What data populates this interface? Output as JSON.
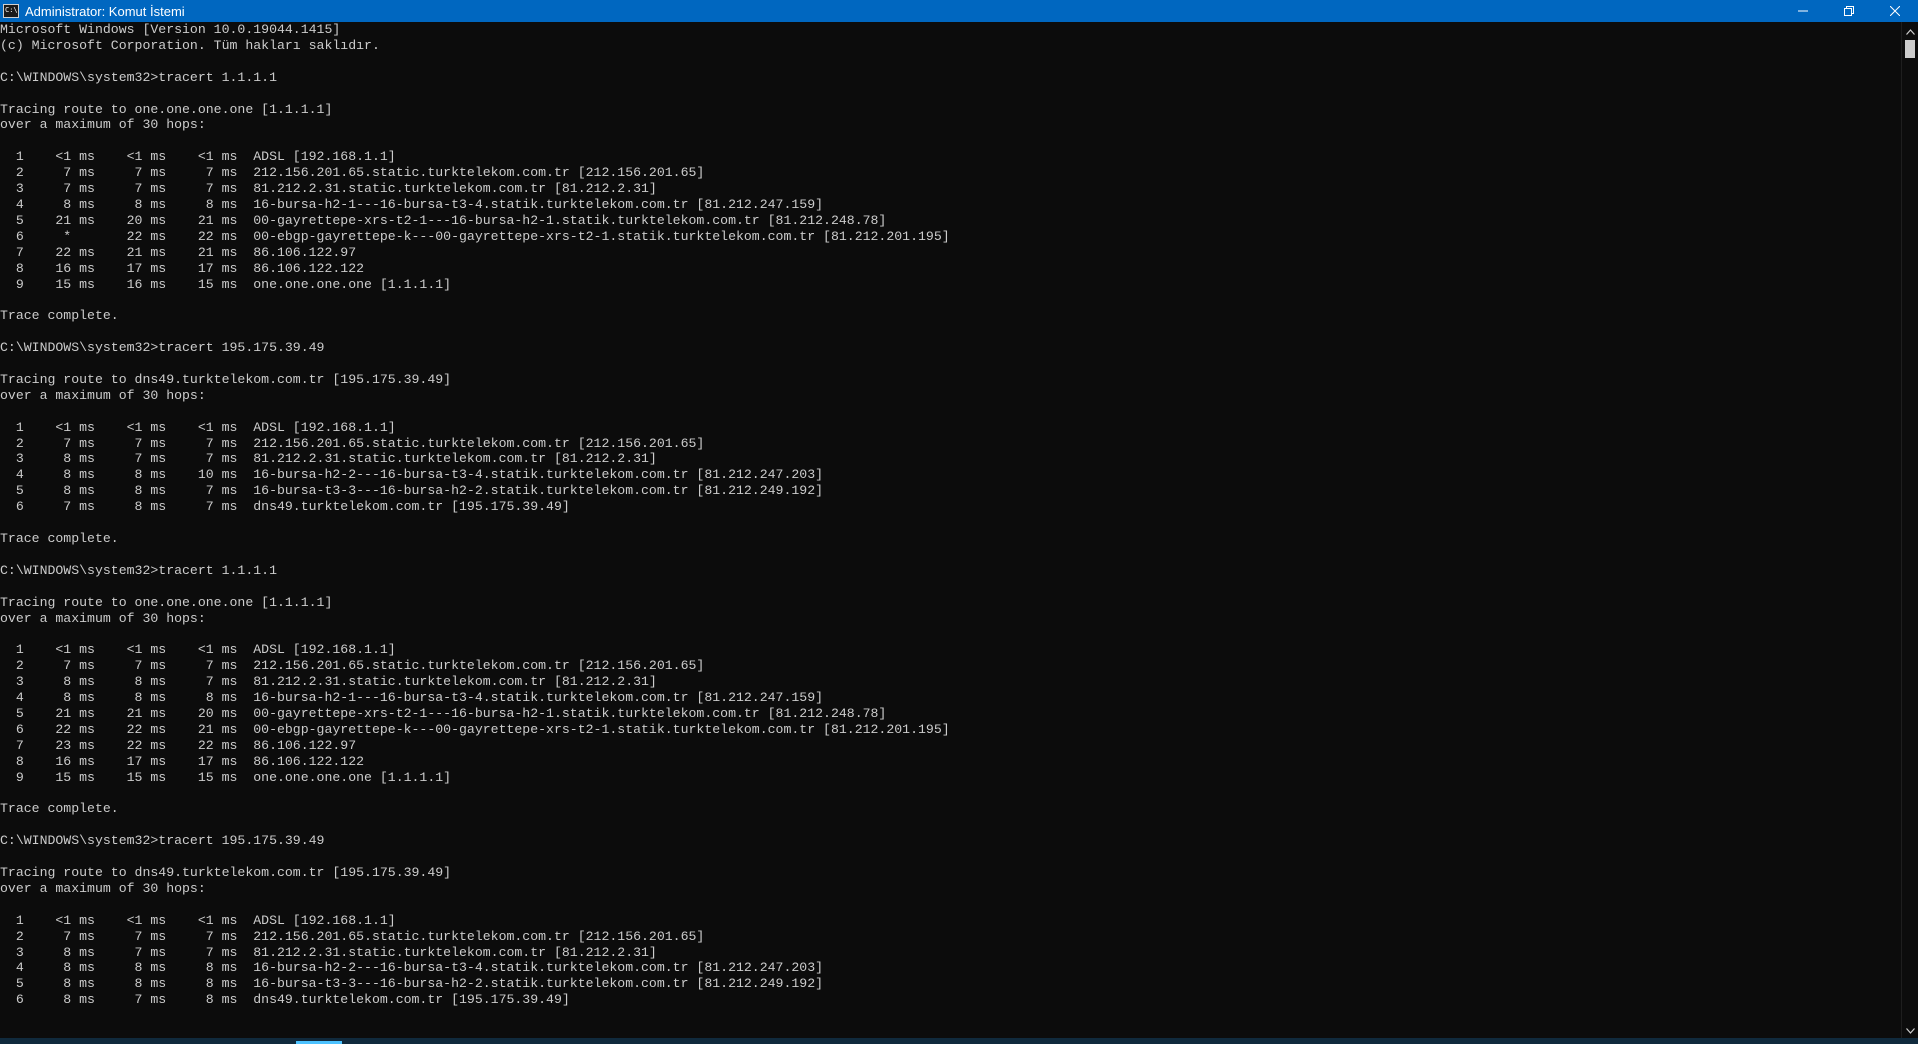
{
  "window": {
    "title": "Administrator: Komut İstemi",
    "icon_text": "C:\\",
    "controls": {
      "minimize": "minimize-icon",
      "restore": "restore-icon",
      "close": "close-icon"
    }
  },
  "console": {
    "lines": [
      "Microsoft Windows [Version 10.0.19044.1415]",
      "(c) Microsoft Corporation. Tüm hakları saklıdır.",
      "",
      "C:\\WINDOWS\\system32>tracert 1.1.1.1",
      "",
      "Tracing route to one.one.one.one [1.1.1.1]",
      "over a maximum of 30 hops:",
      "",
      "  1    <1 ms    <1 ms    <1 ms  ADSL [192.168.1.1]",
      "  2     7 ms     7 ms     7 ms  212.156.201.65.static.turktelekom.com.tr [212.156.201.65]",
      "  3     7 ms     7 ms     7 ms  81.212.2.31.static.turktelekom.com.tr [81.212.2.31]",
      "  4     8 ms     8 ms     8 ms  16-bursa-h2-1---16-bursa-t3-4.statik.turktelekom.com.tr [81.212.247.159]",
      "  5    21 ms    20 ms    21 ms  00-gayrettepe-xrs-t2-1---16-bursa-h2-1.statik.turktelekom.com.tr [81.212.248.78]",
      "  6     *       22 ms    22 ms  00-ebgp-gayrettepe-k---00-gayrettepe-xrs-t2-1.statik.turktelekom.com.tr [81.212.201.195]",
      "  7    22 ms    21 ms    21 ms  86.106.122.97",
      "  8    16 ms    17 ms    17 ms  86.106.122.122",
      "  9    15 ms    16 ms    15 ms  one.one.one.one [1.1.1.1]",
      "",
      "Trace complete.",
      "",
      "C:\\WINDOWS\\system32>tracert 195.175.39.49",
      "",
      "Tracing route to dns49.turktelekom.com.tr [195.175.39.49]",
      "over a maximum of 30 hops:",
      "",
      "  1    <1 ms    <1 ms    <1 ms  ADSL [192.168.1.1]",
      "  2     7 ms     7 ms     7 ms  212.156.201.65.static.turktelekom.com.tr [212.156.201.65]",
      "  3     8 ms     7 ms     7 ms  81.212.2.31.static.turktelekom.com.tr [81.212.2.31]",
      "  4     8 ms     8 ms    10 ms  16-bursa-h2-2---16-bursa-t3-4.statik.turktelekom.com.tr [81.212.247.203]",
      "  5     8 ms     8 ms     7 ms  16-bursa-t3-3---16-bursa-h2-2.statik.turktelekom.com.tr [81.212.249.192]",
      "  6     7 ms     8 ms     7 ms  dns49.turktelekom.com.tr [195.175.39.49]",
      "",
      "Trace complete.",
      "",
      "C:\\WINDOWS\\system32>tracert 1.1.1.1",
      "",
      "Tracing route to one.one.one.one [1.1.1.1]",
      "over a maximum of 30 hops:",
      "",
      "  1    <1 ms    <1 ms    <1 ms  ADSL [192.168.1.1]",
      "  2     7 ms     7 ms     7 ms  212.156.201.65.static.turktelekom.com.tr [212.156.201.65]",
      "  3     8 ms     8 ms     7 ms  81.212.2.31.static.turktelekom.com.tr [81.212.2.31]",
      "  4     8 ms     8 ms     8 ms  16-bursa-h2-1---16-bursa-t3-4.statik.turktelekom.com.tr [81.212.247.159]",
      "  5    21 ms    21 ms    20 ms  00-gayrettepe-xrs-t2-1---16-bursa-h2-1.statik.turktelekom.com.tr [81.212.248.78]",
      "  6    22 ms    22 ms    21 ms  00-ebgp-gayrettepe-k---00-gayrettepe-xrs-t2-1.statik.turktelekom.com.tr [81.212.201.195]",
      "  7    23 ms    22 ms    22 ms  86.106.122.97",
      "  8    16 ms    17 ms    17 ms  86.106.122.122",
      "  9    15 ms    15 ms    15 ms  one.one.one.one [1.1.1.1]",
      "",
      "Trace complete.",
      "",
      "C:\\WINDOWS\\system32>tracert 195.175.39.49",
      "",
      "Tracing route to dns49.turktelekom.com.tr [195.175.39.49]",
      "over a maximum of 30 hops:",
      "",
      "  1    <1 ms    <1 ms    <1 ms  ADSL [192.168.1.1]",
      "  2     7 ms     7 ms     7 ms  212.156.201.65.static.turktelekom.com.tr [212.156.201.65]",
      "  3     8 ms     7 ms     7 ms  81.212.2.31.static.turktelekom.com.tr [81.212.2.31]",
      "  4     8 ms     8 ms     8 ms  16-bursa-h2-2---16-bursa-t3-4.statik.turktelekom.com.tr [81.212.247.203]",
      "  5     8 ms     8 ms     8 ms  16-bursa-t3-3---16-bursa-h2-2.statik.turktelekom.com.tr [81.212.249.192]",
      "  6     8 ms     7 ms     8 ms  dns49.turktelekom.com.tr [195.175.39.49]"
    ]
  },
  "scrollbar": {
    "up_icon": "scroll-up-arrow-icon",
    "down_icon": "scroll-down-arrow-icon"
  },
  "colors": {
    "titlebar": "#0067c0",
    "console_bg": "#0c0c0c",
    "console_text": "#cccccc"
  }
}
